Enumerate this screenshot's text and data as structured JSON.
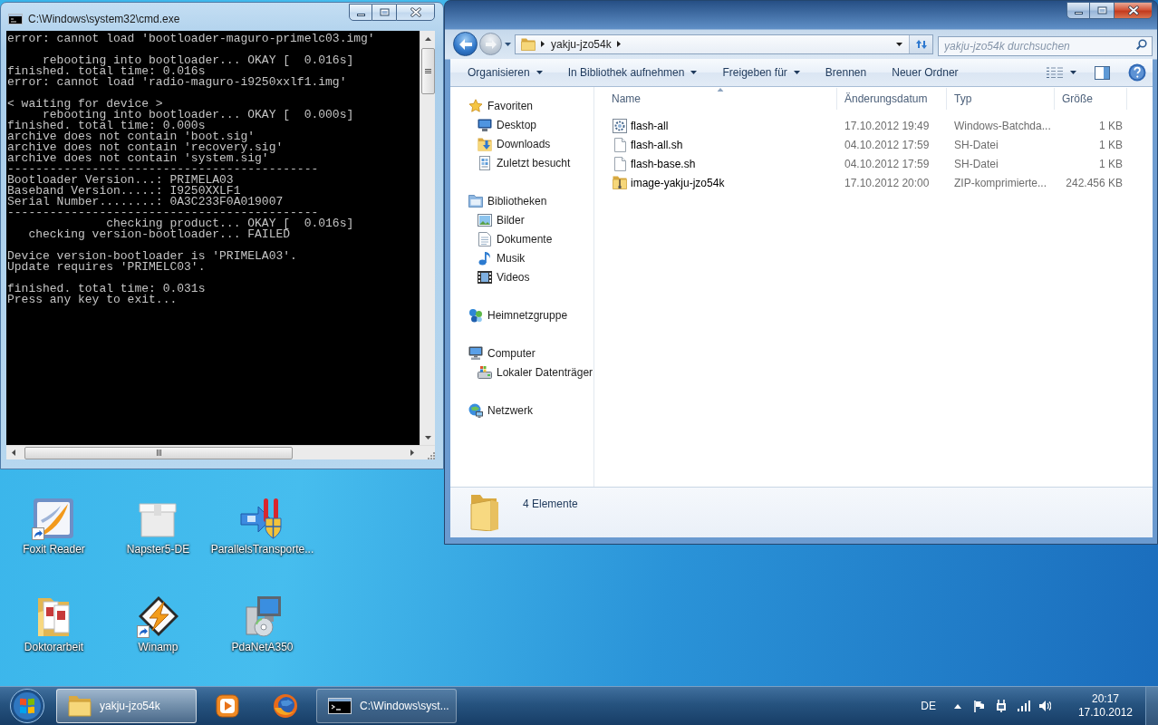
{
  "console_window": {
    "title": "C:\\Windows\\system32\\cmd.exe",
    "active": false,
    "output_blocks": [
      [
        "error: cannot load 'bootloader-maguro-primelc03.img'"
      ],
      [
        "     rebooting into bootloader... OKAY [  0.016s]",
        "finished. total time: 0.016s",
        "error: cannot load 'radio-maguro-i9250xxlf1.img'"
      ],
      [
        "< waiting for device >",
        "     rebooting into bootloader... OKAY [  0.000s]",
        "finished. total time: 0.000s",
        "archive does not contain 'boot.sig'",
        "archive does not contain 'recovery.sig'",
        "archive does not contain 'system.sig'",
        "--------------------------------------------",
        "Bootloader Version...: PRIMELA03",
        "Baseband Version.....: I9250XXLF1",
        "Serial Number........: 0A3C233F0A019007",
        "--------------------------------------------",
        "              checking product... OKAY [  0.016s]",
        "   checking version-bootloader... FAILED"
      ],
      [
        "Device version-bootloader is 'PRIMELA03'.",
        "Update requires 'PRIMELC03'."
      ],
      [
        "finished. total time: 0.031s",
        "Press any key to exit..."
      ]
    ]
  },
  "explorer_window": {
    "active": true,
    "address": {
      "path": [
        "yakju-jzo54k"
      ]
    },
    "search": {
      "placeholder": "yakju-jzo54k durchsuchen"
    },
    "toolbar": [
      {
        "label": "Organisieren",
        "dropdown": true
      },
      {
        "label": "In Bibliothek aufnehmen",
        "dropdown": true
      },
      {
        "label": "Freigeben für",
        "dropdown": true
      },
      {
        "label": "Brennen",
        "dropdown": false
      },
      {
        "label": "Neuer Ordner",
        "dropdown": false
      }
    ],
    "navigation": [
      {
        "label": "Favoriten",
        "children": [
          {
            "label": "Desktop"
          },
          {
            "label": "Downloads"
          },
          {
            "label": "Zuletzt besucht"
          }
        ]
      },
      {
        "label": "Bibliotheken",
        "children": [
          {
            "label": "Bilder"
          },
          {
            "label": "Dokumente"
          },
          {
            "label": "Musik"
          },
          {
            "label": "Videos"
          }
        ]
      },
      {
        "label": "Heimnetzgruppe"
      },
      {
        "label": "Computer",
        "children": [
          {
            "label": "Lokaler Datenträger"
          }
        ]
      },
      {
        "label": "Netzwerk"
      }
    ],
    "columns": [
      {
        "label": "Name",
        "sorted": true
      },
      {
        "label": "Änderungsdatum",
        "sorted": false
      },
      {
        "label": "Typ",
        "sorted": false
      },
      {
        "label": "Größe",
        "sorted": false
      }
    ],
    "files": [
      {
        "name": "flash-all",
        "modified": "17.10.2012 19:49",
        "type": "Windows-Batchda...",
        "size": "1 KB"
      },
      {
        "name": "flash-all.sh",
        "modified": "04.10.2012 17:59",
        "type": "SH-Datei",
        "size": "1 KB"
      },
      {
        "name": "flash-base.sh",
        "modified": "04.10.2012 17:59",
        "type": "SH-Datei",
        "size": "1 KB"
      },
      {
        "name": "image-yakju-jzo54k",
        "modified": "17.10.2012 20:00",
        "type": "ZIP-komprimierte...",
        "size": "242.456 KB"
      }
    ],
    "status_bar": {
      "item_count": "4 Elemente"
    }
  },
  "desktop_icons": [
    {
      "label": "Foxit Reader",
      "shortcut": true
    },
    {
      "label": "Napster5-DE",
      "shortcut": false
    },
    {
      "label": "ParallelsTransporte...",
      "shortcut": false
    },
    {
      "label": "Doktorarbeit",
      "shortcut": false
    },
    {
      "label": "Winamp",
      "shortcut": true
    },
    {
      "label": "PdaNetA350",
      "shortcut": false
    }
  ],
  "taskbar": {
    "items": [
      {
        "kind": "window",
        "label": "yakju-jzo54k",
        "selected": true
      },
      {
        "kind": "pinned",
        "selected": false
      },
      {
        "kind": "pinned",
        "selected": false
      },
      {
        "kind": "window",
        "label": "C:\\Windows\\syst...",
        "selected": false
      }
    ],
    "tray": {
      "language": "DE",
      "time": "20:17",
      "date": "17.10.2012"
    }
  }
}
